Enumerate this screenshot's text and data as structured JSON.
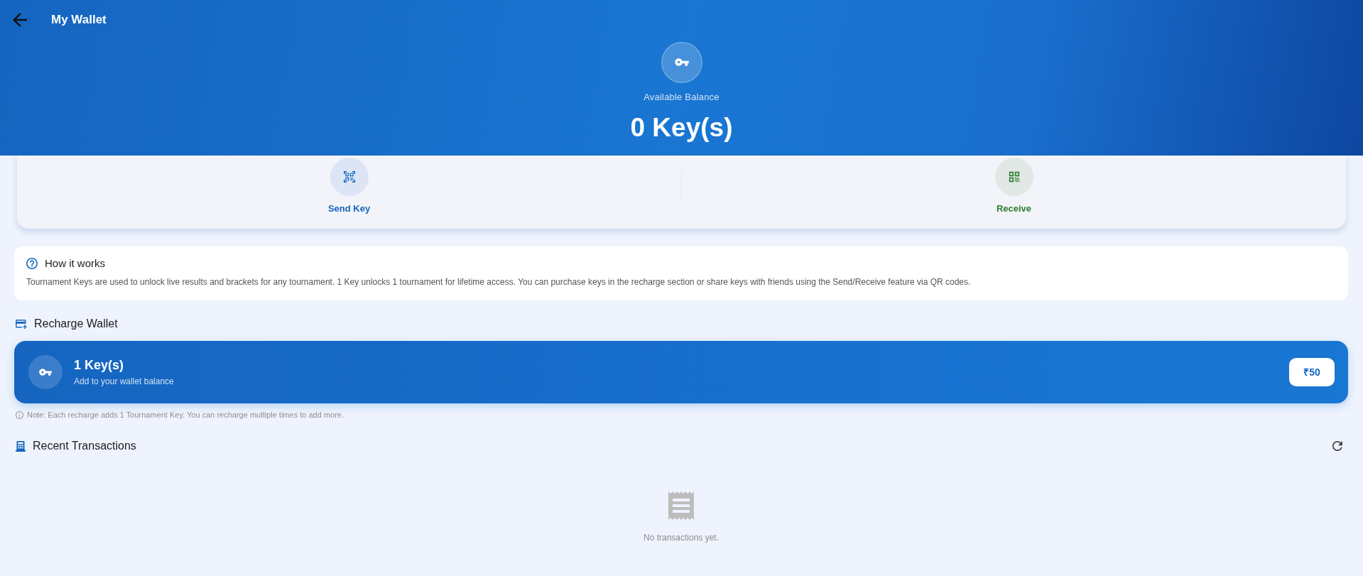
{
  "header": {
    "title": "My Wallet",
    "balance_label": "Available Balance",
    "balance": "0 Key(s)"
  },
  "actions": [
    {
      "kind": "send",
      "label": "Send Key"
    },
    {
      "kind": "receive",
      "label": "Receive"
    }
  ],
  "info": {
    "title": "How it works",
    "text": "Tournament Keys are used to unlock live results and brackets for any tournament. 1 Key unlocks 1 tournament for lifetime access. You can purchase keys in the recharge section or share keys with friends using the Send/Receive feature via QR codes."
  },
  "recharge": {
    "title": "Recharge Wallet",
    "options": [
      {
        "title": "1 Key(s)",
        "subtitle": "Add to your wallet balance",
        "price": "₹50"
      }
    ],
    "note": "Note: Each recharge adds 1 Tournament Key. You can recharge multiple times to add more."
  },
  "transactions": {
    "title": "Recent Transactions",
    "empty_text": "No transactions yet."
  }
}
